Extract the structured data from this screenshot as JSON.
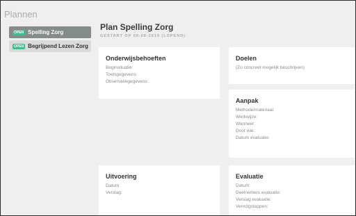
{
  "app": {
    "title": "Plannen"
  },
  "sidebar": {
    "items": [
      {
        "badge": "OPEN",
        "label": "Spelling Zorg"
      },
      {
        "badge": "OPEN",
        "label": "Begrijpend Lezen Zorg"
      }
    ]
  },
  "plan": {
    "title": "Plan Spelling Zorg",
    "subtitle": "GESTART OP 08-08-2019 (LOPEND)"
  },
  "cards": {
    "onderwijsbehoeften": {
      "title": "Onderwijsbehoeften",
      "lines": [
        "Beginsituatie:",
        "Toetsgegevens:",
        "Observatiegegevens:"
      ]
    },
    "doelen": {
      "title": "Doelen",
      "lines": [
        "(Zo concreet mogelijk beschrijven)"
      ]
    },
    "aanpak": {
      "title": "Aanpak",
      "lines": [
        "Methode/materiaal:",
        "Werkwijze:",
        "Wanneer:",
        "Door wie:",
        "Datum evaluatie:"
      ]
    },
    "uitvoering": {
      "title": "Uitvoering",
      "lines": [
        "Datum:",
        "Verslag:"
      ]
    },
    "evaluatie": {
      "title": "Evaluatie",
      "lines": [
        "Datum:",
        "Deelnemers evaluatie:",
        "Verslag evaluatie:",
        "Vervolgstappen:"
      ]
    }
  },
  "colors": {
    "accent_badge": "#3fbf8f",
    "active_item": "#848b8b",
    "background": "#efefef"
  }
}
